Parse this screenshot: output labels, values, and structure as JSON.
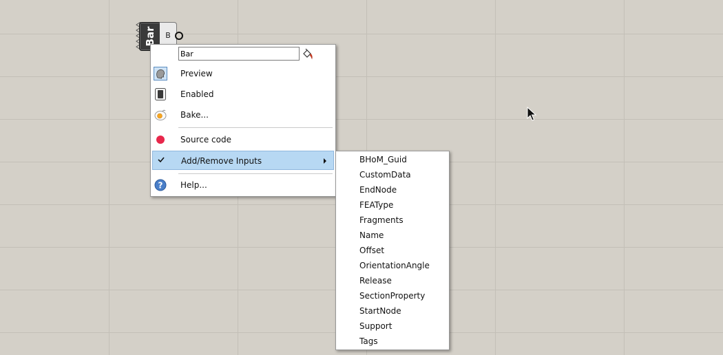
{
  "component": {
    "name": "Bar",
    "output": "B"
  },
  "menu": {
    "name_value": "Bar",
    "items": [
      {
        "label": "Preview",
        "icon": "preview-icon"
      },
      {
        "label": "Enabled",
        "icon": "enabled-icon"
      },
      {
        "label": "Bake...",
        "icon": "bake-icon"
      },
      {
        "label": "Source code",
        "icon": "source-code-icon"
      },
      {
        "label": "Add/Remove Inputs",
        "icon": "checkmark-icon"
      },
      {
        "label": "Help...",
        "icon": "help-icon"
      }
    ]
  },
  "submenu": {
    "items": [
      "BHoM_Guid",
      "CustomData",
      "EndNode",
      "FEAType",
      "Fragments",
      "Name",
      "Offset",
      "OrientationAngle",
      "Release",
      "SectionProperty",
      "StartNode",
      "Support",
      "Tags"
    ]
  },
  "colors": {
    "canvas": "#d4d0c8",
    "grid": "#c3bfb7",
    "highlight": "#b7d8f3",
    "source_dot": "#e8274b"
  }
}
